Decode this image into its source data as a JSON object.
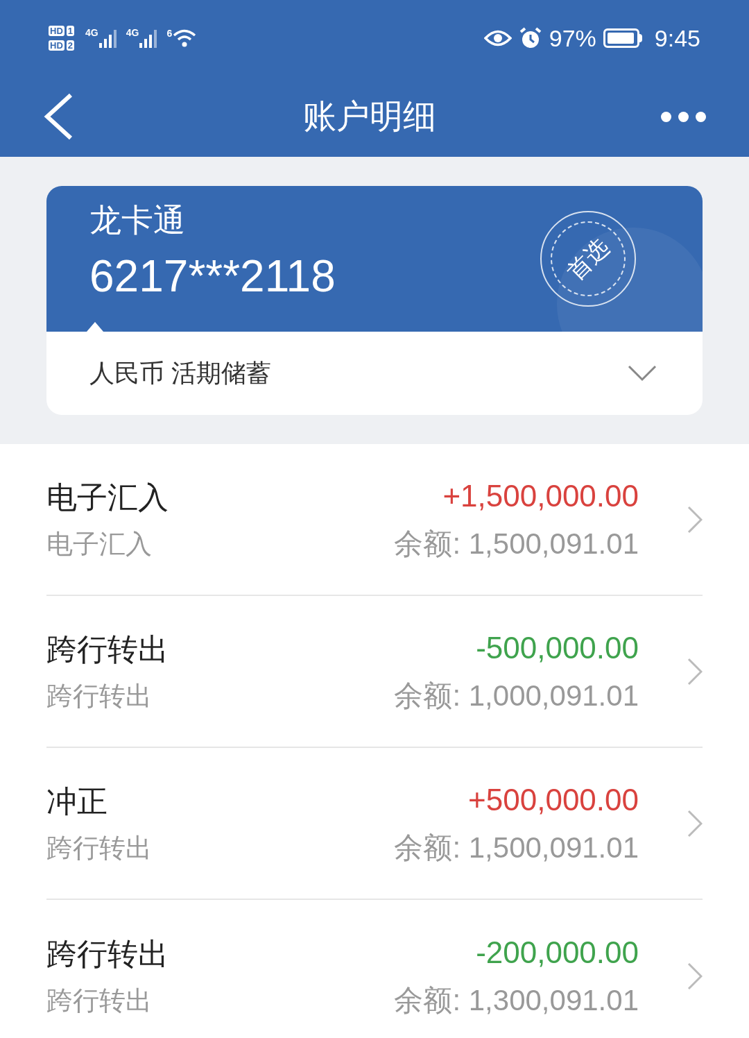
{
  "status_bar": {
    "sims": [
      {
        "hd": "HD",
        "slot": "1"
      },
      {
        "hd": "HD",
        "slot": "2"
      }
    ],
    "networks": [
      "4G",
      "4G"
    ],
    "wifi": "6",
    "battery": "97%",
    "time": "9:45"
  },
  "title_bar": {
    "title": "账户明细"
  },
  "account": {
    "name": "龙卡通",
    "number": "6217***2118",
    "stamp": "首选",
    "type": "人民币 活期储蓄"
  },
  "transactions": [
    {
      "title": "电子汇入",
      "subtitle": "电子汇入",
      "amount": "+1,500,000.00",
      "color": "#d9423e",
      "balance": "余额: 1,500,091.01"
    },
    {
      "title": "跨行转出",
      "subtitle": "跨行转出",
      "amount": "-500,000.00",
      "color": "#3fa34d",
      "balance": "余额: 1,000,091.01"
    },
    {
      "title": "冲正",
      "subtitle": "跨行转出",
      "amount": "+500,000.00",
      "color": "#d9423e",
      "balance": "余额: 1,500,091.01"
    },
    {
      "title": "跨行转出",
      "subtitle": "跨行转出",
      "amount": "-200,000.00",
      "color": "#3fa34d",
      "balance": "余额: 1,300,091.01"
    }
  ]
}
